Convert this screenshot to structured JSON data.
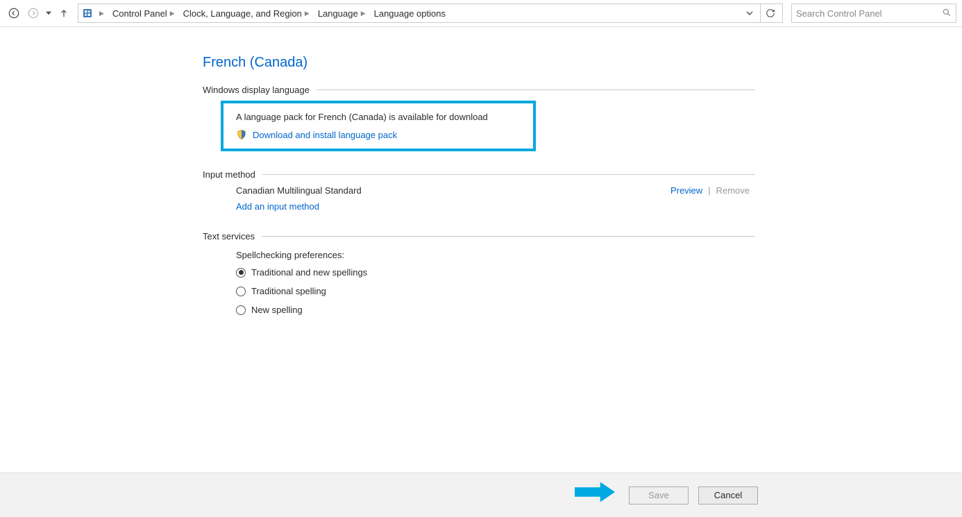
{
  "nav": {
    "breadcrumbs": [
      "Control Panel",
      "Clock, Language, and Region",
      "Language",
      "Language options"
    ],
    "search_placeholder": "Search Control Panel"
  },
  "page": {
    "title": "French (Canada)",
    "sections": {
      "display_lang": {
        "heading": "Windows display language",
        "message": "A language pack for French (Canada) is available for download",
        "download_link": "Download and install language pack"
      },
      "input_method": {
        "heading": "Input method",
        "method_name": "Canadian Multilingual Standard",
        "preview_label": "Preview",
        "remove_label": "Remove",
        "add_label": "Add an input method"
      },
      "text_services": {
        "heading": "Text services",
        "spell_heading": "Spellchecking preferences:",
        "options": [
          {
            "label": "Traditional and new spellings",
            "checked": true
          },
          {
            "label": "Traditional spelling",
            "checked": false
          },
          {
            "label": "New spelling",
            "checked": false
          }
        ]
      }
    }
  },
  "footer": {
    "save": "Save",
    "cancel": "Cancel"
  }
}
